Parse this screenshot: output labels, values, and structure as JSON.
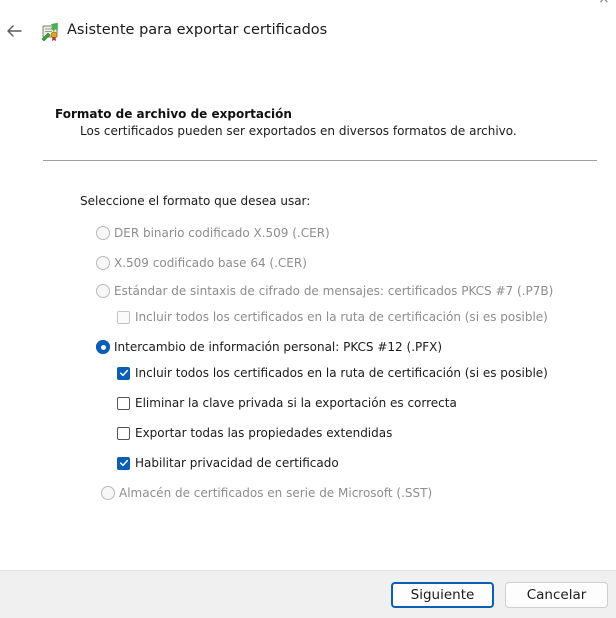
{
  "window": {
    "title": "Asistente para exportar certificados",
    "close_glyph": "×"
  },
  "header": {
    "title": "Formato de archivo de exportación",
    "description": "Los certificados pueden ser exportados en diversos formatos de archivo."
  },
  "prompt": "Seleccione el formato que desea usar:",
  "options": [
    {
      "label": "DER binario codificado X.509 (.CER)",
      "type": "radio",
      "checked": false,
      "enabled": false
    },
    {
      "label": "X.509 codificado base 64 (.CER)",
      "type": "radio",
      "checked": false,
      "enabled": false
    },
    {
      "label": "Estándar de sintaxis de cifrado de mensajes: certificados PKCS #7 (.P7B)",
      "type": "radio",
      "checked": false,
      "enabled": false
    },
    {
      "label": "Incluir todos los certificados en la ruta de certificación (si es posible)",
      "type": "checkbox",
      "checked": false,
      "enabled": false
    },
    {
      "label": "Intercambio de información personal: PKCS #12 (.PFX)",
      "type": "radio",
      "checked": true,
      "enabled": true
    },
    {
      "label": "Incluir todos los certificados en la ruta de certificación (si es posible)",
      "type": "checkbox",
      "checked": true,
      "enabled": true
    },
    {
      "label": "Eliminar la clave privada si la exportación es correcta",
      "type": "checkbox",
      "checked": false,
      "enabled": true
    },
    {
      "label": "Exportar todas las propiedades extendidas",
      "type": "checkbox",
      "checked": false,
      "enabled": true
    },
    {
      "label": "Habilitar privacidad de certificado",
      "type": "checkbox",
      "checked": true,
      "enabled": true
    },
    {
      "label": "Almacén de certificados en serie de Microsoft (.SST)",
      "type": "radio",
      "checked": false,
      "enabled": false
    }
  ],
  "buttons": {
    "next": "Siguiente",
    "cancel": "Cancelar"
  },
  "colors": {
    "accent": "#0a5fb4",
    "disabled_text": "#8d8d8d",
    "footer_bg": "#f0f0f0"
  }
}
